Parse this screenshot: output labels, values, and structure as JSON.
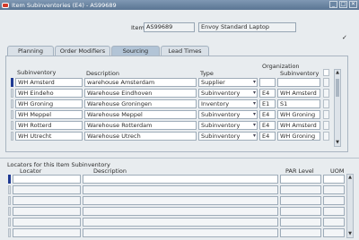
{
  "window": {
    "title": "Item Subinventories (E4) - AS99689",
    "buttons": [
      "_",
      "□",
      "✕"
    ]
  },
  "header": {
    "item_label": "Item",
    "item_value": "AS99689",
    "description_value": "Envoy Standard Laptop",
    "checkbox_checked": "✓"
  },
  "tabs": [
    {
      "label": "Planning"
    },
    {
      "label": "Order Modifiers"
    },
    {
      "label": "Sourcing"
    },
    {
      "label": "Lead Times"
    }
  ],
  "grid": {
    "organization_group": "Organization",
    "columns": {
      "subinventory": "Subinventory",
      "description": "Description",
      "type": "Type",
      "org": "",
      "org_subinventory": "Subinventory"
    },
    "rows": [
      {
        "subinventory": "WH Amsterd",
        "description": "warehouse Amsterdam",
        "type": "Supplier",
        "org": "",
        "org_subinventory": ""
      },
      {
        "subinventory": "WH Eindeho",
        "description": "Warehouse Eindhoven",
        "type": "Subinventory",
        "org": "E4",
        "org_subinventory": "WH Amsterd"
      },
      {
        "subinventory": "WH Groning",
        "description": "Warehouse Groningen",
        "type": "Inventory",
        "org": "E1",
        "org_subinventory": "S1"
      },
      {
        "subinventory": "WH Meppel",
        "description": "Warehouse Meppel",
        "type": "Subinventory",
        "org": "E4",
        "org_subinventory": "WH Groning"
      },
      {
        "subinventory": "WH Rotterd",
        "description": "Warehouse Rotterdam",
        "type": "Subinventory",
        "org": "E4",
        "org_subinventory": "WH Amsterd"
      },
      {
        "subinventory": "WH Utrecht",
        "description": "Warehouse Utrech",
        "type": "Subinventory",
        "org": "E4",
        "org_subinventory": "WH Groning"
      }
    ]
  },
  "locators": {
    "section_title": "Locators for this Item Subinventory",
    "columns": {
      "locator": "Locator",
      "description": "Description",
      "par_level": "PAR Level",
      "uom": "UOM"
    },
    "row_count": 6
  }
}
